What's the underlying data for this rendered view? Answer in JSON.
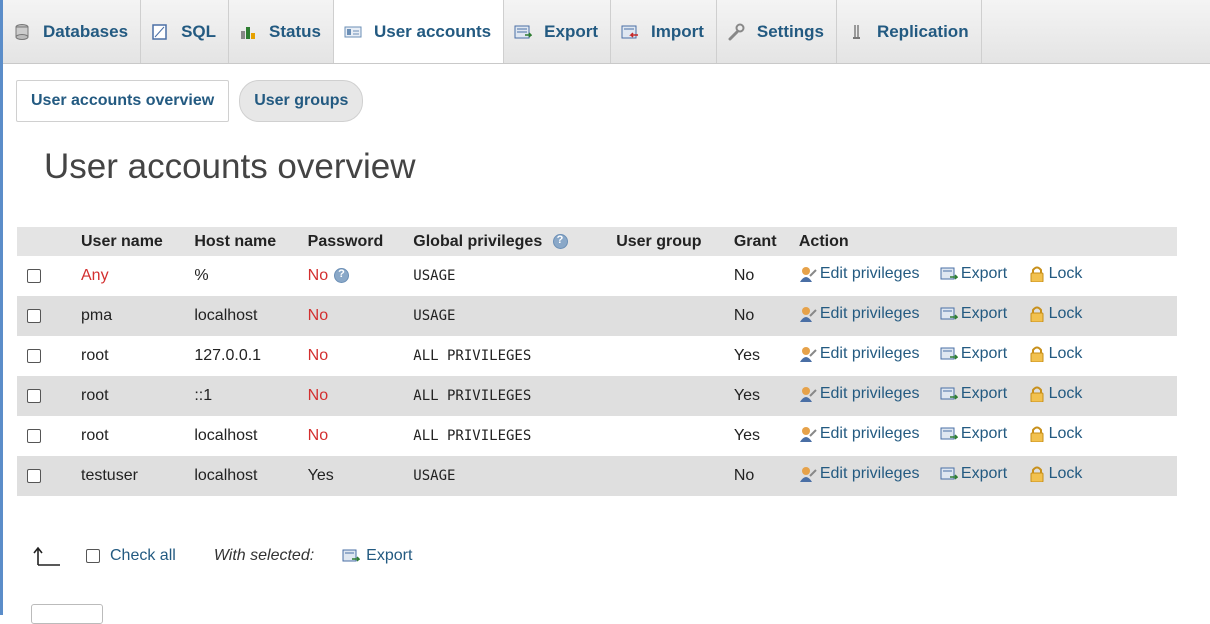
{
  "nav": {
    "tabs": [
      {
        "label": "Databases",
        "icon": "database-icon"
      },
      {
        "label": "SQL",
        "icon": "sql-icon"
      },
      {
        "label": "Status",
        "icon": "status-chart-icon"
      },
      {
        "label": "User accounts",
        "icon": "user-accounts-icon",
        "active": true
      },
      {
        "label": "Export",
        "icon": "export-icon"
      },
      {
        "label": "Import",
        "icon": "import-icon"
      },
      {
        "label": "Settings",
        "icon": "wrench-icon"
      },
      {
        "label": "Replication",
        "icon": "replication-icon"
      }
    ]
  },
  "subtabs": {
    "overview": "User accounts overview",
    "groups": "User groups"
  },
  "page_title": "User accounts overview",
  "table": {
    "headers": {
      "username": "User name",
      "hostname": "Host name",
      "password": "Password",
      "global": "Global privileges",
      "usergroup": "User group",
      "grant": "Grant",
      "action": "Action"
    },
    "rows": [
      {
        "user": "Any",
        "host": "%",
        "password": "No",
        "privileges": "USAGE",
        "usergroup": "",
        "grant": "No"
      },
      {
        "user": "pma",
        "host": "localhost",
        "password": "No",
        "privileges": "USAGE",
        "usergroup": "",
        "grant": "No"
      },
      {
        "user": "root",
        "host": "127.0.0.1",
        "password": "No",
        "privileges": "ALL PRIVILEGES",
        "usergroup": "",
        "grant": "Yes"
      },
      {
        "user": "root",
        "host": "::1",
        "password": "No",
        "privileges": "ALL PRIVILEGES",
        "usergroup": "",
        "grant": "Yes"
      },
      {
        "user": "root",
        "host": "localhost",
        "password": "No",
        "privileges": "ALL PRIVILEGES",
        "usergroup": "",
        "grant": "Yes"
      },
      {
        "user": "testuser",
        "host": "localhost",
        "password": "Yes",
        "privileges": "USAGE",
        "usergroup": "",
        "grant": "No"
      }
    ],
    "actions": {
      "edit": "Edit privileges",
      "export": "Export",
      "lock": "Lock"
    }
  },
  "bottom": {
    "check_all": "Check all",
    "with_selected": "With selected:",
    "export": "Export"
  },
  "colors": {
    "link": "#235a81",
    "no_password": "#d32f2f",
    "row_alt": "#dfdfdf",
    "header_bg": "#e4e4e4"
  }
}
